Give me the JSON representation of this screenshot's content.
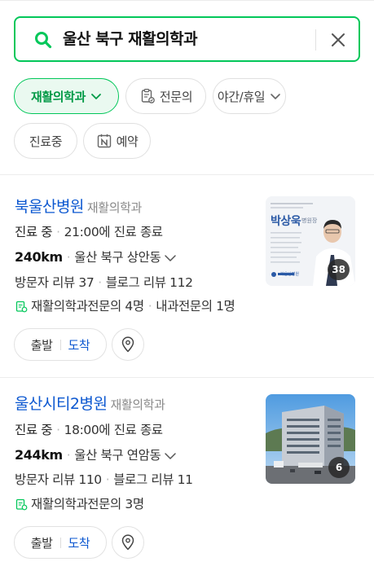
{
  "search": {
    "query": "울산 북구 재활의학과"
  },
  "filters": [
    {
      "label": "재활의학과",
      "active": true,
      "icon": "chevron-down-icon"
    },
    {
      "label": "전문의",
      "active": false,
      "icon": "specialist-clipboard-icon"
    },
    {
      "label": "야간/휴일",
      "active": false,
      "icon": "chevron-down-icon"
    },
    {
      "label": "진료중",
      "active": false,
      "icon": ""
    },
    {
      "label": "예약",
      "active": false,
      "icon": "naver-booking-icon"
    }
  ],
  "results": [
    {
      "name": "북울산병원",
      "category": "재활의학과",
      "status": "진료 중",
      "hours": "21:00에 진료 종료",
      "distance": "240km",
      "area": "울산 북구 상안동",
      "visitor_reviews": "방문자 리뷰 37",
      "blog_reviews": "블로그 리뷰 112",
      "specialists_1": "재활의학과전문의 4명",
      "specialists_2": "내과전문의 1명",
      "photo_count": "38",
      "depart_label": "출발",
      "arrive_label": "도착",
      "thumb_text": {
        "doctor": "박상욱",
        "suffix": "병원장",
        "hospital": "북울산병원"
      }
    },
    {
      "name": "울산시티2병원",
      "category": "재활의학과",
      "status": "진료 중",
      "hours": "18:00에 진료 종료",
      "distance": "244km",
      "area": "울산 북구 연암동",
      "visitor_reviews": "방문자 리뷰 110",
      "blog_reviews": "블로그 리뷰 11",
      "specialists_1": "재활의학과전문의 3명",
      "photo_count": "6",
      "depart_label": "출발",
      "arrive_label": "도착"
    }
  ],
  "colors": {
    "accent": "#03c75a",
    "link": "#0b57d0",
    "active_chip_bg": "#eaf9f0"
  }
}
